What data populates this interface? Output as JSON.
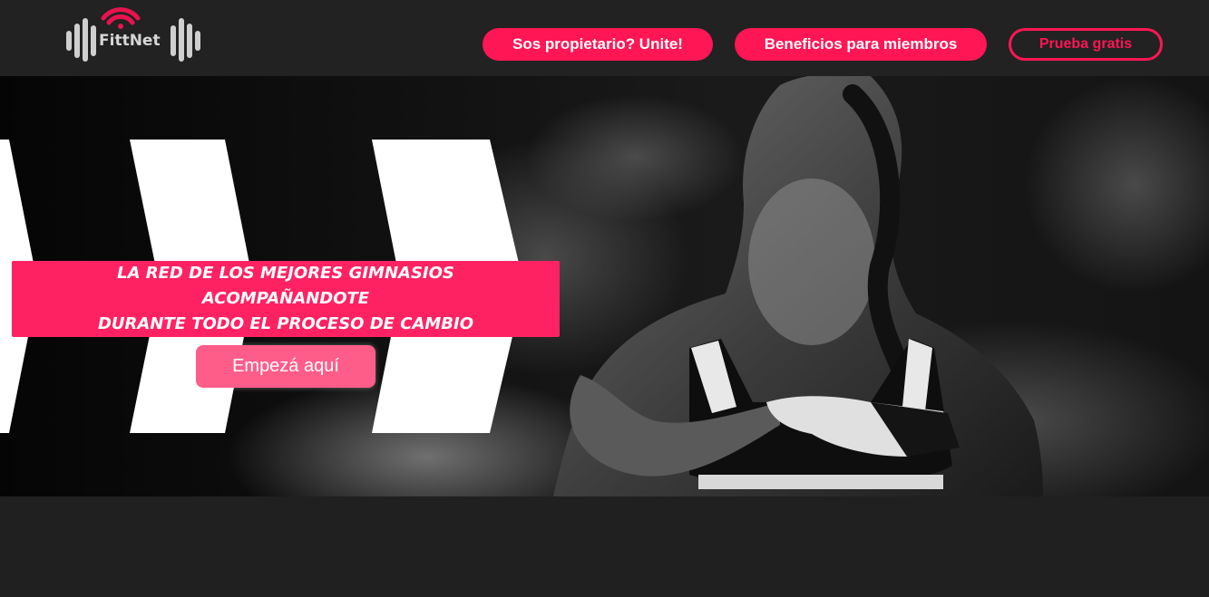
{
  "brand": {
    "name": "FittNet",
    "colors": {
      "accent": "#ff1654",
      "header_bg": "#222222",
      "page_bg": "#202020"
    }
  },
  "nav": {
    "owner_label": "Sos propietario? Unite!",
    "benefits_label": "Beneficios para miembros",
    "trial_label": "Prueba gratis"
  },
  "hero": {
    "tagline_line1": "LA RED DE LOS MEJORES GIMNASIOS ACOMPAÑANDOTE",
    "tagline_line2": "DURANTE TODO EL PROCESO DE CAMBIO",
    "cta_label": "Empezá aquí",
    "image": "athlete-photo"
  }
}
